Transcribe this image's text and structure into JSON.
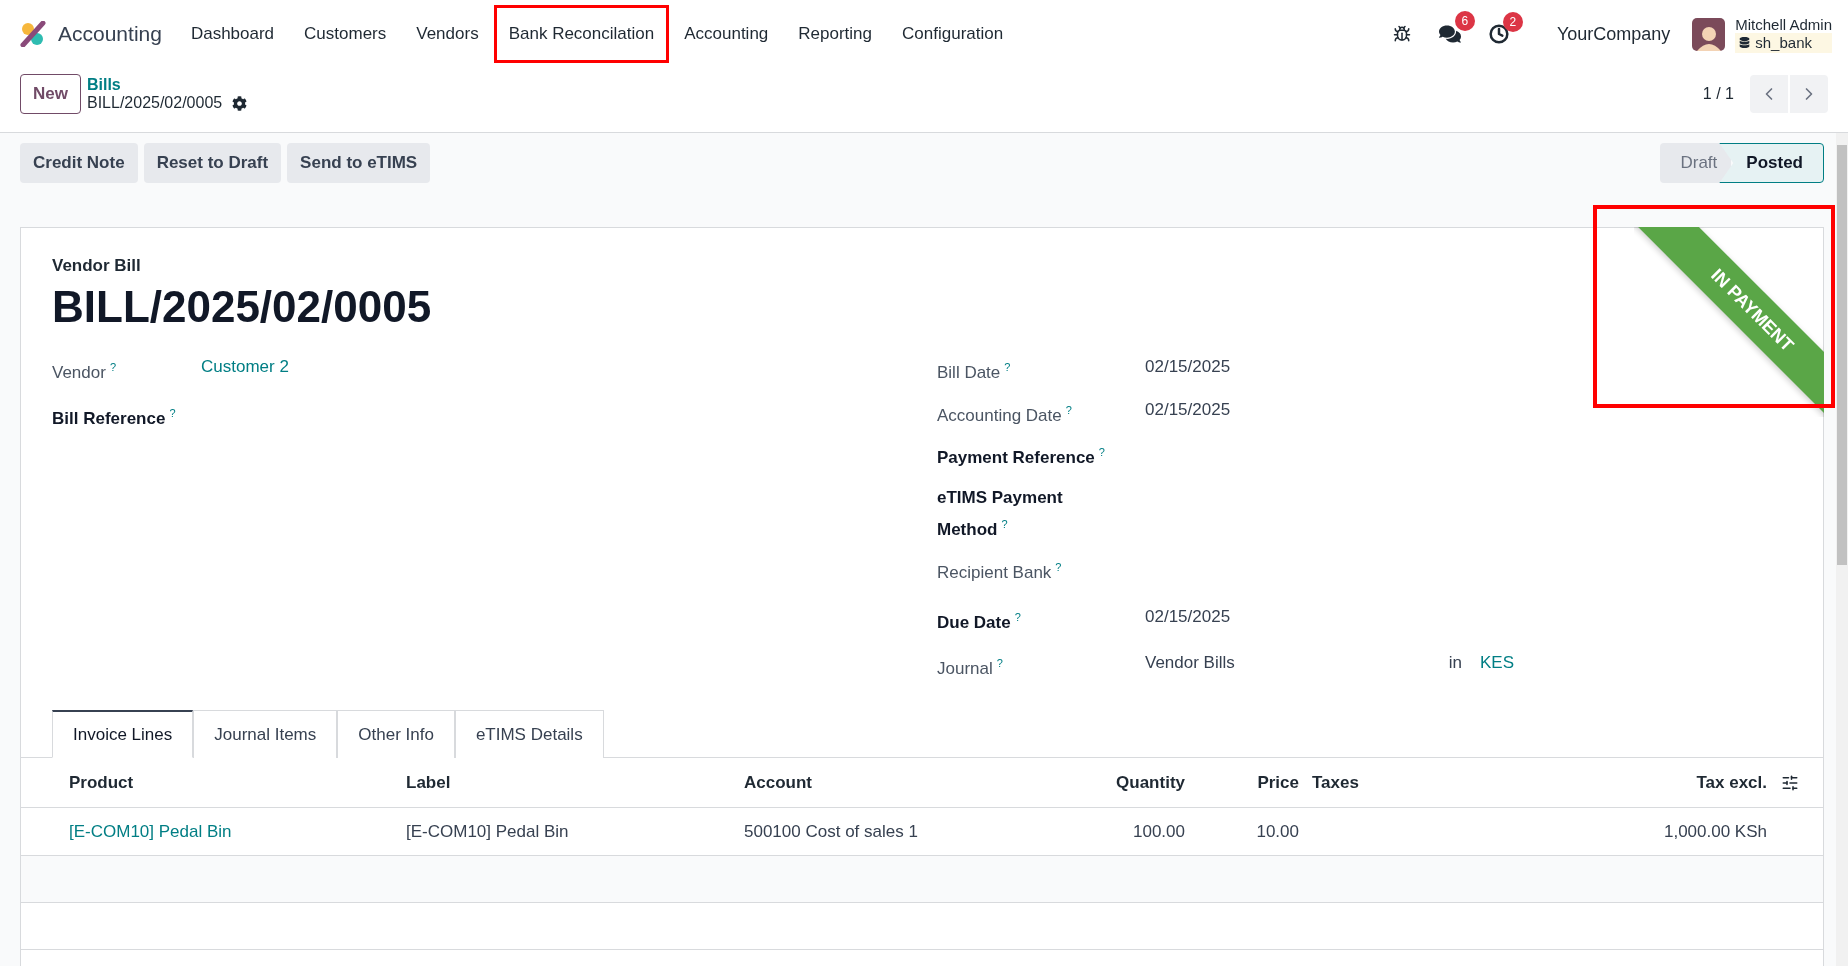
{
  "app": {
    "name": "Accounting"
  },
  "menu": [
    {
      "label": "Dashboard",
      "highlighted": false
    },
    {
      "label": "Customers",
      "highlighted": false
    },
    {
      "label": "Vendors",
      "highlighted": false
    },
    {
      "label": "Bank Reconcilation",
      "highlighted": true
    },
    {
      "label": "Accounting",
      "highlighted": false
    },
    {
      "label": "Reporting",
      "highlighted": false
    },
    {
      "label": "Configuration",
      "highlighted": false
    }
  ],
  "systray": {
    "messages_count": "6",
    "activities_count": "2",
    "company": "YourCompany",
    "user": "Mitchell Admin",
    "database": "sh_bank"
  },
  "control_panel": {
    "new_button": "New",
    "breadcrumb": "Bills",
    "record": "BILL/2025/02/0005",
    "pager": "1 / 1"
  },
  "actions": [
    "Credit Note",
    "Reset to Draft",
    "Send to eTIMS"
  ],
  "statusbar": [
    {
      "label": "Draft",
      "selected": false
    },
    {
      "label": "Posted",
      "selected": true
    }
  ],
  "ribbon": {
    "text": "IN PAYMENT",
    "highlighted": true
  },
  "form": {
    "type_label": "Vendor Bill",
    "name": "BILL/2025/02/0005",
    "left_fields": [
      {
        "label": "Vendor",
        "help": "?",
        "required": false,
        "value": "Customer 2",
        "kind": "link"
      },
      {
        "label": "Bill Reference",
        "help": "?",
        "required": true
      }
    ],
    "right_fields": [
      {
        "label": "Bill Date",
        "help": "?",
        "required": false,
        "value": "02/15/2025"
      },
      {
        "label": "Accounting Date",
        "help": "?",
        "required": false,
        "value": "02/15/2025"
      },
      {
        "label": "Payment Reference",
        "help": "?",
        "required": true
      },
      {
        "label": "eTIMS Payment Method",
        "help": "?",
        "required": true
      },
      {
        "label": "Recipient Bank",
        "help": "?",
        "required": false
      },
      {
        "label": "Due Date",
        "help": "?",
        "required": true,
        "value": "02/15/2025"
      },
      {
        "label": "Journal",
        "help": "?",
        "required": false,
        "value": "Vendor Bills",
        "suffix": "in",
        "suffix_link": "KES"
      }
    ]
  },
  "tabs": [
    {
      "label": "Invoice Lines",
      "selected": true
    },
    {
      "label": "Journal Items",
      "selected": false
    },
    {
      "label": "Other Info",
      "selected": false
    },
    {
      "label": "eTIMS Details",
      "selected": false
    }
  ],
  "table": {
    "columns": [
      {
        "label": "Product",
        "kind": "link"
      },
      {
        "label": "Label",
        "kind": "text"
      },
      {
        "label": "Account",
        "kind": "text"
      },
      {
        "label": "Quantity",
        "kind": "number"
      },
      {
        "label": "Price",
        "kind": "number"
      },
      {
        "label": "Taxes",
        "kind": "text"
      },
      {
        "label": "Tax excl.",
        "kind": "number"
      }
    ],
    "rows": [
      {
        "cells": [
          "[E-COM10] Pedal Bin",
          "[E-COM10] Pedal Bin",
          "500100 Cost of sales 1",
          "100.00",
          "10.00",
          "",
          "1,000.00 KSh"
        ]
      }
    ]
  }
}
